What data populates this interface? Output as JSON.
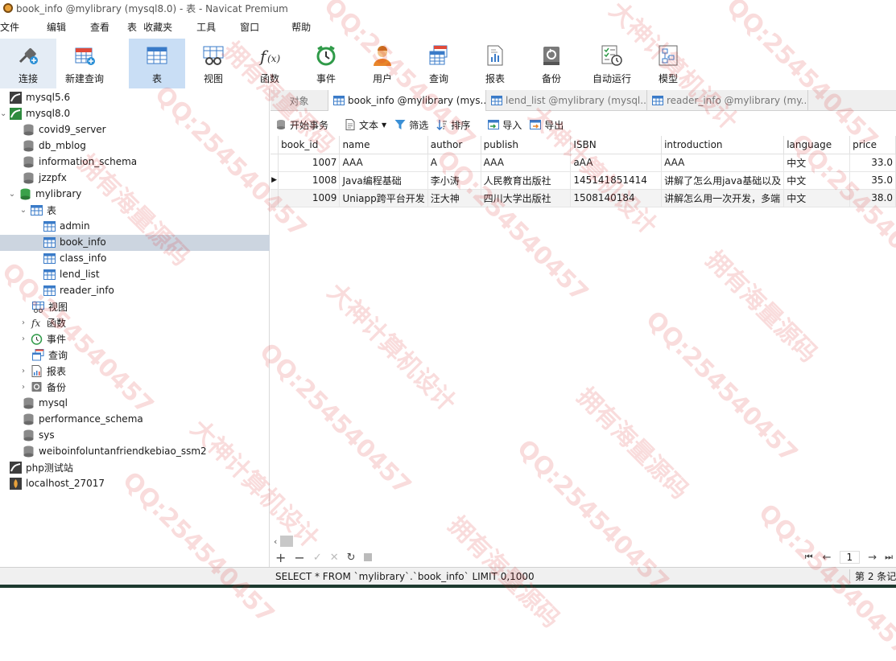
{
  "window": {
    "title": "book_info @mylibrary (mysql8.0) - 表 - Navicat Premium"
  },
  "menu": [
    "文件",
    "编辑",
    "查看",
    "表",
    "收藏夹",
    "工具",
    "窗口",
    "帮助"
  ],
  "toolbar": [
    "连接",
    "新建查询",
    "表",
    "视图",
    "函数",
    "事件",
    "用户",
    "查询",
    "报表",
    "备份",
    "自动运行",
    "模型"
  ],
  "tree": {
    "mysql56": "mysql5.6",
    "mysql80": "mysql8.0",
    "covid9": "covid9_server",
    "db_mblog": "db_mblog",
    "information_schema": "information_schema",
    "jzzpfx": "jzzpfx",
    "mylibrary": "mylibrary",
    "tables": "表",
    "admin": "admin",
    "book_info": "book_info",
    "class_info": "class_info",
    "lend_list": "lend_list",
    "reader_info": "reader_info",
    "views": "视图",
    "functions": "函数",
    "events": "事件",
    "queries": "查询",
    "reports": "报表",
    "backups": "备份",
    "mysql": "mysql",
    "performance_schema": "performance_schema",
    "sys": "sys",
    "weibo": "weiboinfoluntanfriendkebiao_ssm2",
    "php": "php测试站",
    "localhost": "localhost_27017"
  },
  "tabs": {
    "objects": "对象",
    "book_info": "book_info @mylibrary (mys...",
    "lend_list": "lend_list @mylibrary (mysql...",
    "reader_info": "reader_info @mylibrary (my..."
  },
  "objtoolbar": {
    "begin": "开始事务",
    "text": "文本",
    "filter": "筛选",
    "sort": "排序",
    "import": "导入",
    "export": "导出"
  },
  "grid": {
    "columns": [
      "book_id",
      "name",
      "author",
      "publish",
      "ISBN",
      "introduction",
      "language",
      "price"
    ],
    "rows": [
      [
        "1007",
        "AAA",
        "A",
        "AAA",
        "aAA",
        "AAA",
        "中文",
        "33.0"
      ],
      [
        "1008",
        "Java编程基础",
        "李小涛",
        "人民教育出版社",
        "145141851414",
        "讲解了怎么用java基础以及",
        "中文",
        "35.0"
      ],
      [
        "1009",
        "Uniapp跨平台开发",
        "汪大神",
        "四川大学出版社",
        "1508140184",
        "讲解怎么用一次开发，多端",
        "中文",
        "38.0"
      ]
    ]
  },
  "pager": {
    "page": "1"
  },
  "status": {
    "sql": "SELECT * FROM `mylibrary`.`book_info` LIMIT 0,1000",
    "records": "第 2 条记"
  },
  "watermarks": {
    "qq": "QQ:254540457",
    "owner": "拥有海量源码",
    "design": "大神计算机设计"
  },
  "colors": {
    "accent": "#c9def5",
    "selected_row": "#ccd5e0",
    "watermark": "#d72828"
  }
}
